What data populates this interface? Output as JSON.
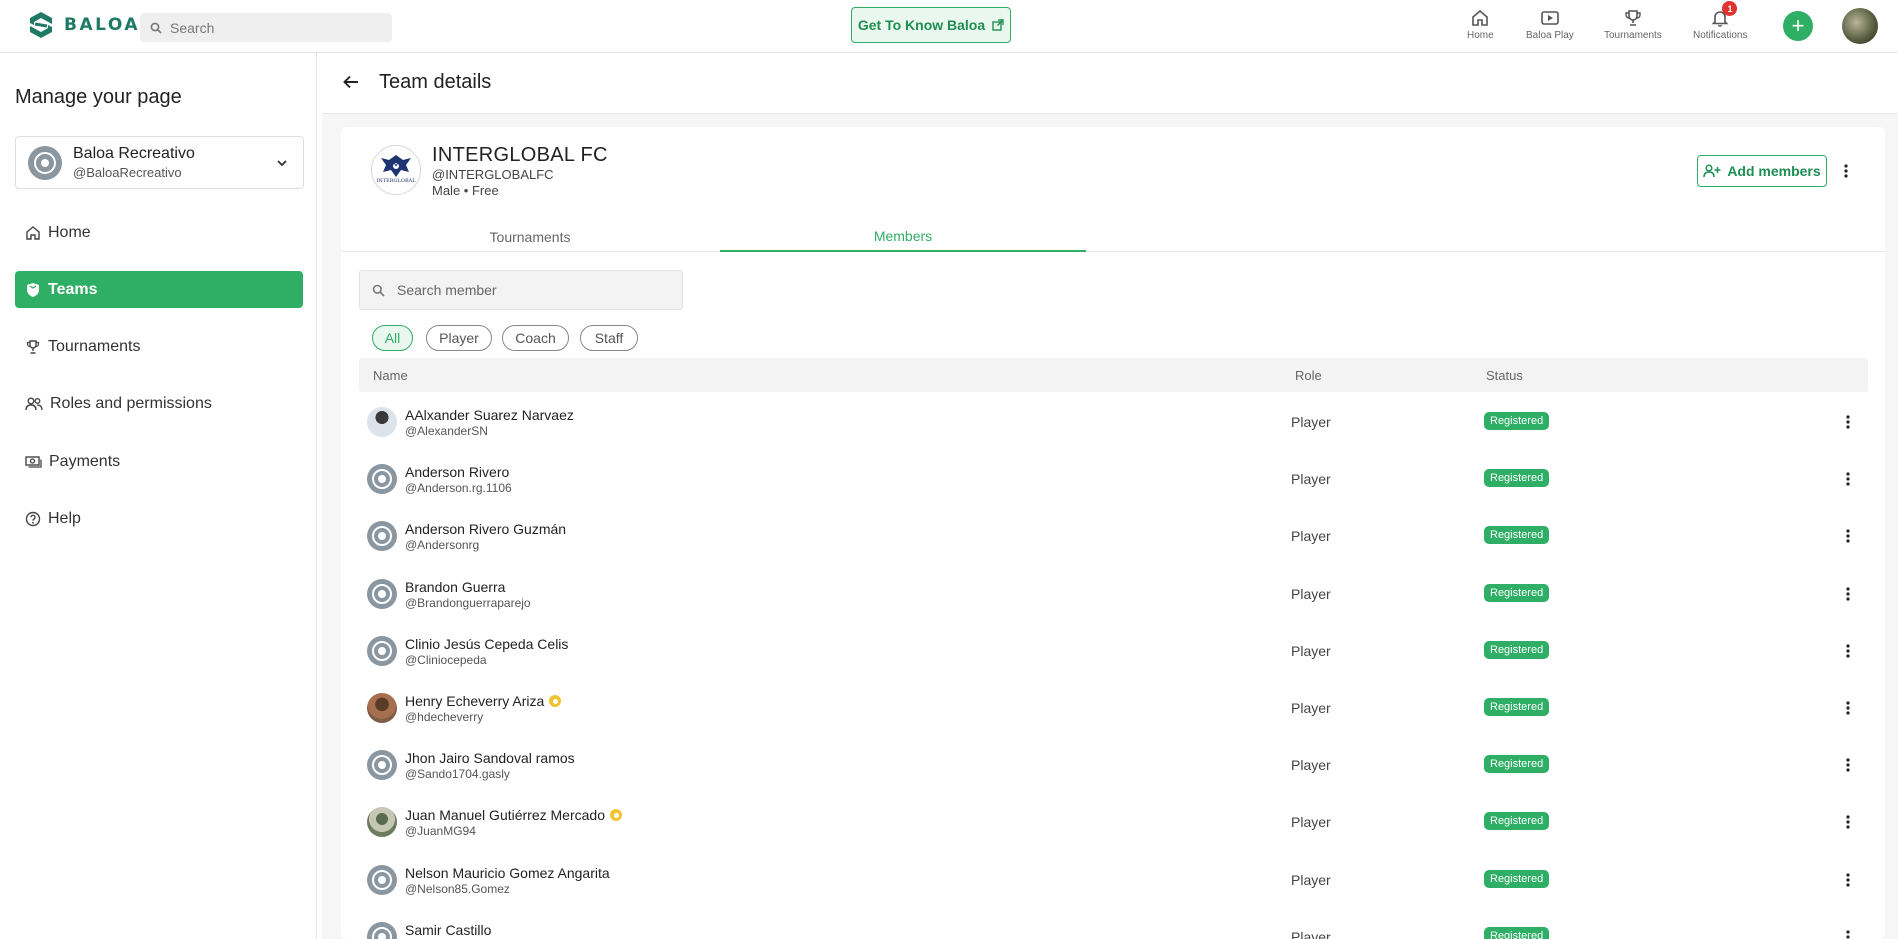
{
  "topbar": {
    "logo_text": "BALOA",
    "search_placeholder": "Search",
    "get_to_know_label": "Get To Know Baloa",
    "nav": [
      {
        "label": "Home",
        "icon": "home-icon"
      },
      {
        "label": "Baloa Play",
        "icon": "play-icon"
      },
      {
        "label": "Tournaments",
        "icon": "trophy-icon"
      },
      {
        "label": "Notifications",
        "icon": "bell-icon",
        "badge": "1"
      }
    ],
    "plus_label": "+"
  },
  "sidebar": {
    "title": "Manage your page",
    "page": {
      "name": "Baloa Recreativo",
      "handle": "@BaloaRecreativo"
    },
    "items": [
      {
        "label": "Home",
        "icon": "home-icon",
        "active": false
      },
      {
        "label": "Teams",
        "icon": "shield-icon",
        "active": true
      },
      {
        "label": "Tournaments",
        "icon": "trophy-icon",
        "active": false
      },
      {
        "label": "Roles and permissions",
        "icon": "users-icon",
        "active": false
      },
      {
        "label": "Payments",
        "icon": "money-icon",
        "active": false
      },
      {
        "label": "Help",
        "icon": "help-icon",
        "active": false
      }
    ]
  },
  "main": {
    "title": "Team details",
    "team": {
      "name": "INTERGLOBAL FC",
      "handle": "@INTERGLOBALFC",
      "meta": "Male • Free",
      "logo_text": "INTERGLOBAL"
    },
    "add_members_label": "Add members",
    "tabs": [
      {
        "label": "Tournaments",
        "active": false
      },
      {
        "label": "Members",
        "active": true
      }
    ],
    "search_placeholder": "Search member",
    "filters": [
      {
        "label": "All",
        "active": true
      },
      {
        "label": "Player",
        "active": false
      },
      {
        "label": "Coach",
        "active": false
      },
      {
        "label": "Staff",
        "active": false
      }
    ],
    "columns": {
      "name": "Name",
      "role": "Role",
      "status": "Status"
    },
    "members": [
      {
        "name": "AAlxander Suarez Narvaez",
        "handle": "@AlexanderSN",
        "role": "Player",
        "status": "Registered",
        "avatar": "photo1",
        "verified": false
      },
      {
        "name": "Anderson Rivero",
        "handle": "@Anderson.rg.1106",
        "role": "Player",
        "status": "Registered",
        "avatar": "default",
        "verified": false
      },
      {
        "name": "Anderson Rivero Guzmán",
        "handle": "@Andersonrg",
        "role": "Player",
        "status": "Registered",
        "avatar": "default",
        "verified": false
      },
      {
        "name": "Brandon Guerra",
        "handle": "@Brandonguerraparejo",
        "role": "Player",
        "status": "Registered",
        "avatar": "default",
        "verified": false
      },
      {
        "name": "Clinio Jesús Cepeda Celis",
        "handle": "@Cliniocepeda",
        "role": "Player",
        "status": "Registered",
        "avatar": "default",
        "verified": false
      },
      {
        "name": "Henry Echeverry Ariza",
        "handle": "@hdecheverry",
        "role": "Player",
        "status": "Registered",
        "avatar": "photo2",
        "verified": true
      },
      {
        "name": "Jhon Jairo Sandoval ramos",
        "handle": "@Sando1704.gasly",
        "role": "Player",
        "status": "Registered",
        "avatar": "default",
        "verified": false
      },
      {
        "name": "Juan Manuel Gutiérrez Mercado",
        "handle": "@JuanMG94",
        "role": "Player",
        "status": "Registered",
        "avatar": "photo3",
        "verified": true
      },
      {
        "name": "Nelson Mauricio Gomez Angarita",
        "handle": "@Nelson85.Gomez",
        "role": "Player",
        "status": "Registered",
        "avatar": "default",
        "verified": false
      },
      {
        "name": "Samir Castillo",
        "handle": "",
        "role": "Player",
        "status": "Registered",
        "avatar": "default",
        "verified": false
      }
    ]
  },
  "colors": {
    "accent": "#2fae65",
    "brand": "#1e7a64",
    "badge": "#e0322f"
  }
}
